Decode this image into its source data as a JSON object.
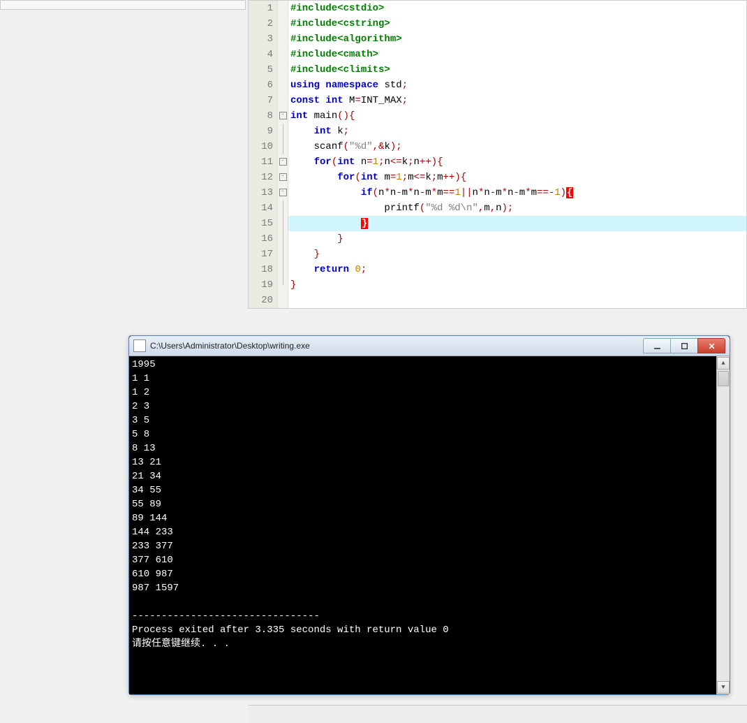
{
  "editor": {
    "lines": [
      {
        "n": "1",
        "fold": "",
        "tokens": [
          [
            "pre",
            "#include"
          ],
          [
            "pre",
            "<cstdio>"
          ]
        ]
      },
      {
        "n": "2",
        "fold": "",
        "tokens": [
          [
            "pre",
            "#include"
          ],
          [
            "pre",
            "<cstring>"
          ]
        ]
      },
      {
        "n": "3",
        "fold": "",
        "tokens": [
          [
            "pre",
            "#include"
          ],
          [
            "pre",
            "<algorithm>"
          ]
        ]
      },
      {
        "n": "4",
        "fold": "",
        "tokens": [
          [
            "pre",
            "#include"
          ],
          [
            "pre",
            "<cmath>"
          ]
        ]
      },
      {
        "n": "5",
        "fold": "",
        "tokens": [
          [
            "pre",
            "#include"
          ],
          [
            "pre",
            "<climits>"
          ]
        ]
      },
      {
        "n": "6",
        "fold": "",
        "tokens": [
          [
            "kw",
            "using"
          ],
          [
            "ident",
            " "
          ],
          [
            "kw",
            "namespace"
          ],
          [
            "ident",
            " std"
          ],
          [
            "punc",
            ";"
          ]
        ]
      },
      {
        "n": "7",
        "fold": "",
        "tokens": [
          [
            "kw",
            "const"
          ],
          [
            "ident",
            " "
          ],
          [
            "kw",
            "int"
          ],
          [
            "ident",
            " M"
          ],
          [
            "punc",
            "="
          ],
          [
            "ident",
            "INT_MAX"
          ],
          [
            "punc",
            ";"
          ]
        ]
      },
      {
        "n": "8",
        "fold": "box",
        "tokens": [
          [
            "kw",
            "int"
          ],
          [
            "ident",
            " main"
          ],
          [
            "punc",
            "()"
          ],
          [
            "punc",
            "{"
          ]
        ]
      },
      {
        "n": "9",
        "fold": "line",
        "indent": 1,
        "tokens": [
          [
            "kw",
            "int"
          ],
          [
            "ident",
            " k"
          ],
          [
            "punc",
            ";"
          ]
        ]
      },
      {
        "n": "10",
        "fold": "line",
        "indent": 1,
        "tokens": [
          [
            "ident",
            "scanf"
          ],
          [
            "punc",
            "("
          ],
          [
            "str",
            "\"%d\""
          ],
          [
            "punc",
            ",&"
          ],
          [
            "ident",
            "k"
          ],
          [
            "punc",
            ");"
          ]
        ]
      },
      {
        "n": "11",
        "fold": "box",
        "indent": 1,
        "tokens": [
          [
            "kw",
            "for"
          ],
          [
            "punc",
            "("
          ],
          [
            "kw",
            "int"
          ],
          [
            "ident",
            " n"
          ],
          [
            "punc",
            "="
          ],
          [
            "num",
            "1"
          ],
          [
            "punc",
            ";"
          ],
          [
            "ident",
            "n"
          ],
          [
            "punc",
            "<="
          ],
          [
            "ident",
            "k"
          ],
          [
            "punc",
            ";"
          ],
          [
            "ident",
            "n"
          ],
          [
            "punc",
            "++){"
          ]
        ]
      },
      {
        "n": "12",
        "fold": "box",
        "indent": 2,
        "tokens": [
          [
            "kw",
            "for"
          ],
          [
            "punc",
            "("
          ],
          [
            "kw",
            "int"
          ],
          [
            "ident",
            " m"
          ],
          [
            "punc",
            "="
          ],
          [
            "num",
            "1"
          ],
          [
            "punc",
            ";"
          ],
          [
            "ident",
            "m"
          ],
          [
            "punc",
            "<="
          ],
          [
            "ident",
            "k"
          ],
          [
            "punc",
            ";"
          ],
          [
            "ident",
            "m"
          ],
          [
            "punc",
            "++){"
          ]
        ]
      },
      {
        "n": "13",
        "fold": "box",
        "indent": 3,
        "tokens": [
          [
            "kw",
            "if"
          ],
          [
            "punc",
            "("
          ],
          [
            "ident",
            "n"
          ],
          [
            "punc",
            "*"
          ],
          [
            "ident",
            "n"
          ],
          [
            "punc",
            "-"
          ],
          [
            "ident",
            "m"
          ],
          [
            "punc",
            "*"
          ],
          [
            "ident",
            "n"
          ],
          [
            "punc",
            "-"
          ],
          [
            "ident",
            "m"
          ],
          [
            "punc",
            "*"
          ],
          [
            "ident",
            "m"
          ],
          [
            "punc",
            "=="
          ],
          [
            "num",
            "1"
          ],
          [
            "punc",
            "||"
          ],
          [
            "ident",
            "n"
          ],
          [
            "punc",
            "*"
          ],
          [
            "ident",
            "n"
          ],
          [
            "punc",
            "-"
          ],
          [
            "ident",
            "m"
          ],
          [
            "punc",
            "*"
          ],
          [
            "ident",
            "n"
          ],
          [
            "punc",
            "-"
          ],
          [
            "ident",
            "m"
          ],
          [
            "punc",
            "*"
          ],
          [
            "ident",
            "m"
          ],
          [
            "punc",
            "==-"
          ],
          [
            "num",
            "1"
          ],
          [
            "punc",
            ")"
          ],
          [
            "brmatch",
            "{"
          ]
        ]
      },
      {
        "n": "14",
        "fold": "line",
        "indent": 4,
        "tokens": [
          [
            "ident",
            "printf"
          ],
          [
            "punc",
            "("
          ],
          [
            "str",
            "\"%d %d\\n\""
          ],
          [
            "punc",
            ","
          ],
          [
            "ident",
            "m"
          ],
          [
            "punc",
            ","
          ],
          [
            "ident",
            "n"
          ],
          [
            "punc",
            ");"
          ]
        ]
      },
      {
        "n": "15",
        "fold": "line",
        "indent": 3,
        "hl": true,
        "tokens": [
          [
            "brmatch",
            "}"
          ]
        ]
      },
      {
        "n": "16",
        "fold": "line",
        "indent": 2,
        "tokens": [
          [
            "punc",
            "}"
          ]
        ]
      },
      {
        "n": "17",
        "fold": "line",
        "indent": 1,
        "tokens": [
          [
            "punc",
            "}"
          ]
        ]
      },
      {
        "n": "18",
        "fold": "line",
        "indent": 1,
        "tokens": [
          [
            "kw",
            "return"
          ],
          [
            "ident",
            " "
          ],
          [
            "num",
            "0"
          ],
          [
            "punc",
            ";"
          ]
        ]
      },
      {
        "n": "19",
        "fold": "end",
        "tokens": [
          [
            "punc",
            "}"
          ]
        ]
      },
      {
        "n": "20",
        "fold": "",
        "tokens": []
      }
    ]
  },
  "console": {
    "title": "C:\\Users\\Administrator\\Desktop\\writing.exe",
    "lines": [
      "1995",
      "1 1",
      "1 2",
      "2 3",
      "3 5",
      "5 8",
      "8 13",
      "13 21",
      "21 34",
      "34 55",
      "55 89",
      "89 144",
      "144 233",
      "233 377",
      "377 610",
      "610 987",
      "987 1597",
      "",
      "--------------------------------",
      "Process exited after 3.335 seconds with return value 0",
      "请按任意键继续. . ."
    ]
  }
}
